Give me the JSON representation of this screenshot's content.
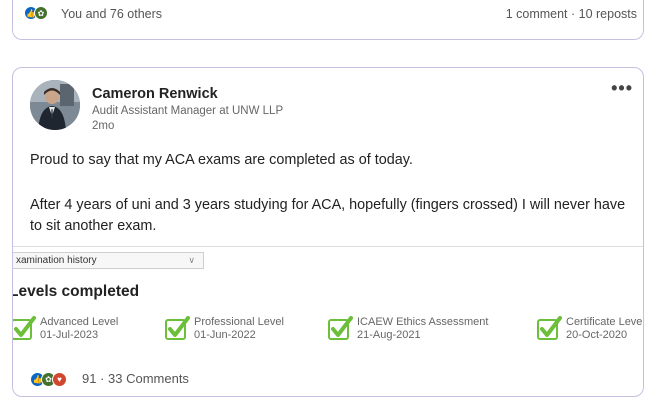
{
  "top_card": {
    "reactions_text": "You and 76 others",
    "engagement_text": "1 comment · 10 reposts",
    "reaction_icons": [
      "like-icon",
      "celebrate-icon"
    ]
  },
  "post": {
    "author": {
      "name": "Cameron Renwick",
      "title": "Audit Assistant Manager at UNW LLP",
      "time": "2mo"
    },
    "more_label": "•••",
    "text_line1": "Proud to say that my ACA exams are completed as of today.",
    "text_line2": "After 4 years of uni and 3 years studying for ACA, hopefully (fingers crossed) I will never have",
    "text_line3": "to sit another exam.",
    "attachment": {
      "dropdown_label": "xamination history",
      "heading": "Levels completed",
      "levels": [
        {
          "name": "Advanced Level",
          "date": "01-Jul-2023"
        },
        {
          "name": "Professional Level",
          "date": "01-Jun-2022"
        },
        {
          "name": "ICAEW Ethics Assessment",
          "date": "21-Aug-2021"
        },
        {
          "name": "Certificate Level",
          "date": "20-Oct-2020"
        }
      ]
    },
    "footer": {
      "reaction_icons": [
        "like-icon",
        "celebrate-icon",
        "love-icon"
      ],
      "stats_text": "91 · 33 Comments"
    }
  },
  "colors": {
    "card_border": "#c8bfe0",
    "like_blue": "#0a66c2",
    "celebrate_green": "#44712e",
    "love_red": "#d0462f",
    "check_green": "#6cbf3a"
  }
}
